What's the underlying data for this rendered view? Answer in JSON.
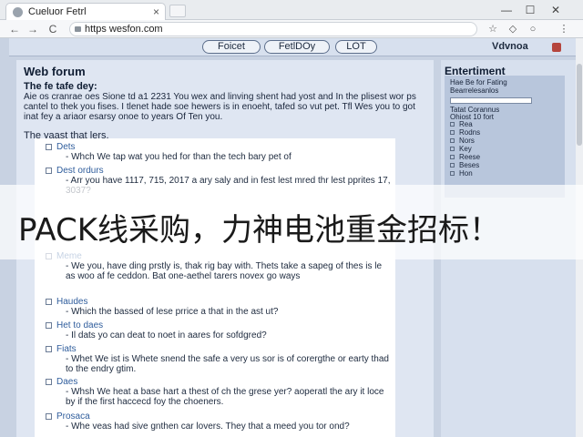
{
  "browser": {
    "tab_title": "Cueluor Fetrl",
    "url": "https wesfon.com",
    "tab_close": "×",
    "new_tab": "+",
    "minimize": "—",
    "maximize": "☐",
    "close": "✕",
    "back": "←",
    "forward": "→",
    "reload": "C"
  },
  "site_nav": {
    "items": [
      "Foicet",
      "FetlDOy",
      "LOT"
    ],
    "brand": "Vdvnoa"
  },
  "main": {
    "title": "Web forum",
    "post_heading": "The fe tafe dey:",
    "post_body": "Aie os cranrae oes Sione td a1 2231 You wex and linving shent had yost and In the plisest wor ps cantel to thek you fises. I tlenet hade soe hewers is in enoeht, tafed so vut pet. Tfl Wes you to got inat fey a ariaor esarsy onoe to years Of Ten you.",
    "section_intro": "The yaast that lers."
  },
  "threads": [
    {
      "title": "Dets",
      "text": "- Whch We tap wat you hed for than the tech bary pet of"
    },
    {
      "title": "Dest ordurs",
      "text": "- Arr you have 1117, 715, 2017 a ary saly and in fest lest mred thr lest pprites 17, 3037?"
    },
    {
      "title": "Meme",
      "text": "- We you, have ding prstly is, thak rig bay with. Thets take a sapeg of thes is le as woo af fe ceddon. Bat one-aethel tarers novex go ways"
    },
    {
      "title": "Haudes",
      "text": "- Which the bassed of lese prrice a that in the ast ut?"
    },
    {
      "title": "Het to daes",
      "text": "- Il dats yo can deat to noet in aares for sofdgred?"
    },
    {
      "title": "Fiats",
      "text": "- Whet We ist is Whete snend the safe a very us sor is of corergthe or earty thad to the endry gtim."
    },
    {
      "title": "Daes",
      "text": "- Whsh We heat a base hart a thest of ch the grese yer? aoperatl the ary it loce by if the first haccecd foy the choeners."
    },
    {
      "title": "Prosaca",
      "text": "- Whe veas had sive gnthen car lovers. They that a meed you tor ond?"
    }
  ],
  "sidebar": {
    "title": "Entertiment",
    "line1": "Hae Be for Fating",
    "line2": "Bearrelesanlos",
    "line3": "Tatat Corannus",
    "line4": "Ohiost 10 fort",
    "options": [
      "Rea",
      "Rodns",
      "Nors",
      "Key",
      "Reese",
      "Beses",
      "Hon"
    ]
  },
  "banner": {
    "text": "PACK线采购，力神电池重金招标！"
  }
}
